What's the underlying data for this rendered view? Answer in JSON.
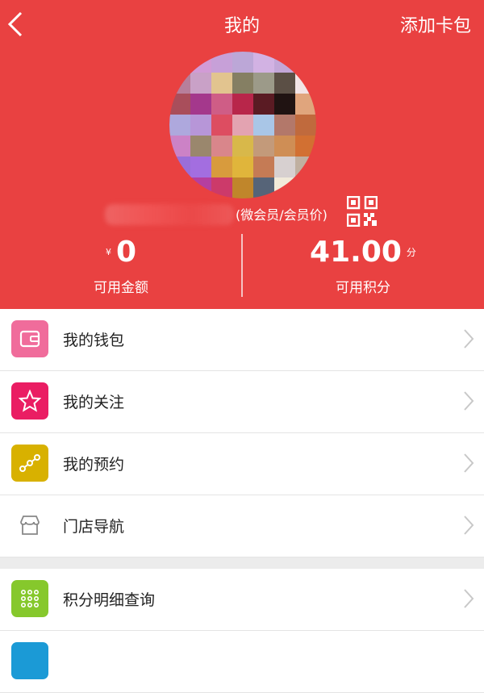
{
  "header": {
    "title": "我的",
    "add_card_label": "添加卡包",
    "member_type": "(微会员/会员价)",
    "colors": {
      "primary": "#e94141"
    }
  },
  "stats": {
    "balance": {
      "currency": "¥",
      "value": "0",
      "label": "可用金额"
    },
    "points": {
      "value": "41.00",
      "unit": "分",
      "label": "可用积分"
    }
  },
  "menu": {
    "items": [
      {
        "label": "我的钱包",
        "icon": "wallet-icon",
        "color": "#f06c9b"
      },
      {
        "label": "我的关注",
        "icon": "star-icon",
        "color": "#ea1d63"
      },
      {
        "label": "我的预约",
        "icon": "route-icon",
        "color": "#d8b100"
      },
      {
        "label": "门店导航",
        "icon": "store-icon",
        "color": "#ffffff"
      },
      {
        "label": "积分明细查询",
        "icon": "grid-icon",
        "color": "#86c82c"
      }
    ]
  }
}
